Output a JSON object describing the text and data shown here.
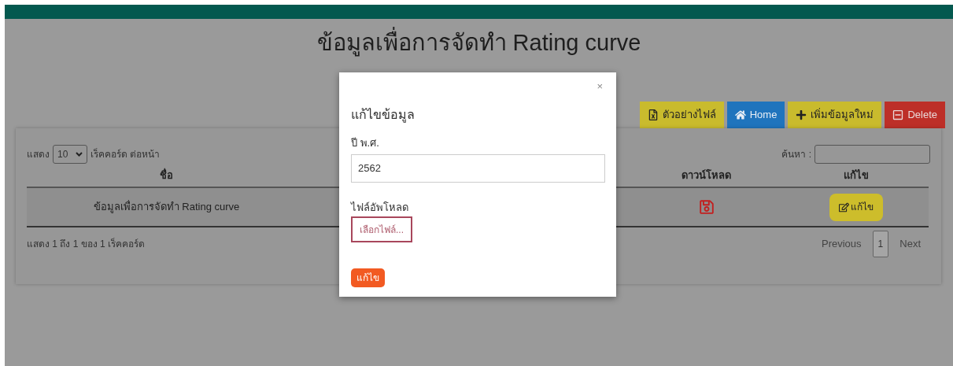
{
  "header": {
    "title": "ข้อมูลเพื่อการจัดทำ Rating curve"
  },
  "toolbar": [
    {
      "kind": "excel",
      "label": "ตัวอย่างไฟล์"
    },
    {
      "kind": "home",
      "label": "Home"
    },
    {
      "kind": "add",
      "label": "เพิ่มข้อมูลใหม่"
    },
    {
      "kind": "delete",
      "label": "Delete"
    }
  ],
  "table": {
    "length_prefix": "แสดง",
    "length_value": "10",
    "length_suffix": "เร็คคอร์ด ต่อหน้า",
    "search_label": "ค้นหา :",
    "columns": [
      "ชื่อ",
      "ดาวน์โหลด",
      "แก้ไข"
    ],
    "rows": [
      {
        "name": "ข้อมูลเพื่อการจัดทำ Rating curve",
        "edit": "แก้ไข"
      }
    ],
    "info": "แสดง 1 ถึง 1 ของ 1 เร็คคอร์ด",
    "pagination": [
      {
        "label": "Previous",
        "selected": false
      },
      {
        "label": "1",
        "selected": true
      },
      {
        "label": "Next",
        "selected": false
      }
    ]
  },
  "modal": {
    "close": "×",
    "title": "แก้ไขข้อมูล",
    "year_label": "ปี พ.ศ.",
    "year_value": "2562",
    "file_label": "ไฟล์อัพโหลด",
    "file_button": "เลือกไฟล์...",
    "submit": "แก้ไข"
  }
}
